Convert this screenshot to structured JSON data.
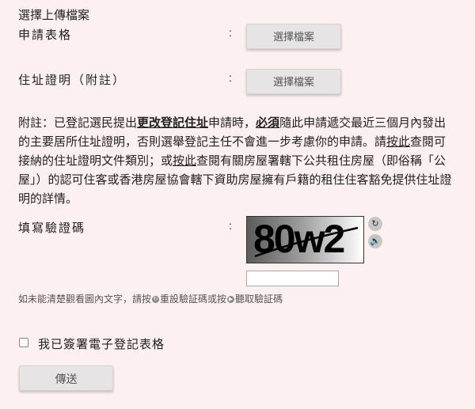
{
  "section_title": "選擇上傳檔案",
  "rows": [
    {
      "label": "申請表格",
      "colon": ":",
      "button_label": "選擇檔案"
    },
    {
      "label": "住址證明（附註）",
      "colon": ":",
      "button_label": "選擇檔案"
    }
  ],
  "note": {
    "p1": "附註：已登記選民提出",
    "bold1": "更改登記住址",
    "p2": "申請時，",
    "bold2": "必須",
    "p3": "隨此申請遞交最近三個月內發出的主要居所住址證明，否則選舉登記主任不會進一步考慮你的申請。請",
    "link1": "按此",
    "p4": "查閱可接納的住址證明文件類別；或",
    "link2": "按此",
    "p5": "查閱有關房屋署轄下公共租住房屋（即俗稱「公屋」）的認可住客或香港房屋協會轄下資助房屋擁有戶籍的租住住客豁免提供住址證明的詳情。"
  },
  "captcha": {
    "label": "填寫驗證碼",
    "colon": ":",
    "image_text": "80w2",
    "refresh_icon": "refresh-icon",
    "audio_icon": "speaker-icon",
    "input_value": ""
  },
  "hint": {
    "p1": "如未能清楚觀看圖內文字，請按",
    "p2": "重設驗証碼或按",
    "p3": "聽取驗証碼"
  },
  "confirm_label": "我已簽署電子登記表格",
  "submit_label": "傳送",
  "colors": {
    "background": "#fdf0f0",
    "button": "#e6e4e4"
  }
}
